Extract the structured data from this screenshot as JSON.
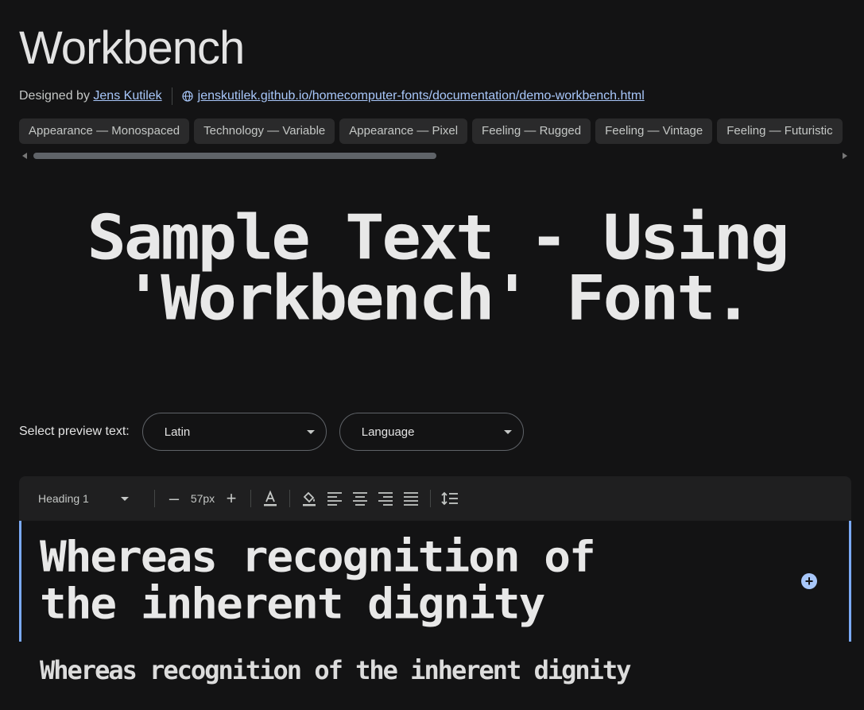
{
  "header": {
    "title": "Workbench",
    "designed_by_label": "Designed by",
    "designer": "Jens Kutilek",
    "url": "jenskutilek.github.io/homecomputer-fonts/documentation/demo-workbench.html"
  },
  "tags": [
    "Appearance — Monospaced",
    "Technology — Variable",
    "Appearance — Pixel",
    "Feeling — Rugged",
    "Feeling — Vintage",
    "Feeling — Futuristic"
  ],
  "sample": {
    "line1": "Sample Text - Using",
    "line2": "'Workbench' Font."
  },
  "preview_select": {
    "label": "Select preview text:",
    "script_value": "Latin",
    "language_value": "Language"
  },
  "toolbar": {
    "style": "Heading 1",
    "decrease": "–",
    "size": "57px",
    "increase": "+"
  },
  "editor": {
    "heading_text": "Whereas recognition of the inherent dignity",
    "preview_text": "Whereas recognition of the inherent dignity"
  },
  "colors": {
    "background": "#131314",
    "accent": "#a8c7fa",
    "focus_border": "#7baaf7"
  }
}
